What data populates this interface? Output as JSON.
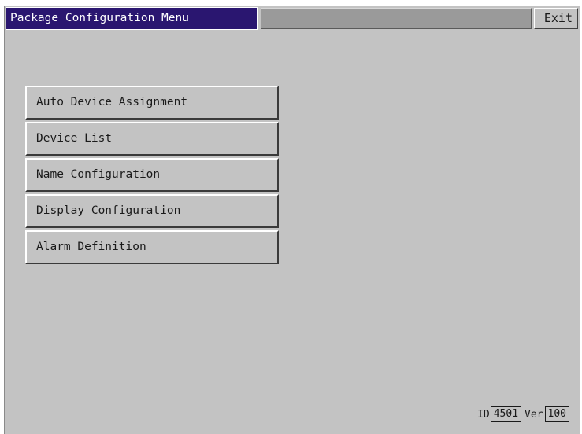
{
  "window": {
    "title": "Package Configuration Menu",
    "exit_label": "Exit"
  },
  "menu": {
    "items": [
      {
        "label": "Auto Device Assignment"
      },
      {
        "label": "Device List"
      },
      {
        "label": "Name Configuration"
      },
      {
        "label": "Display Configuration"
      },
      {
        "label": "Alarm Definition"
      }
    ]
  },
  "footer": {
    "id_label": "ID",
    "id_value": "4501",
    "ver_label": "Ver",
    "ver_value": "100"
  },
  "colors": {
    "title_background": "#2a1670",
    "panel_background": "#c3c3c3",
    "title_fill": "#9a9a9a"
  }
}
